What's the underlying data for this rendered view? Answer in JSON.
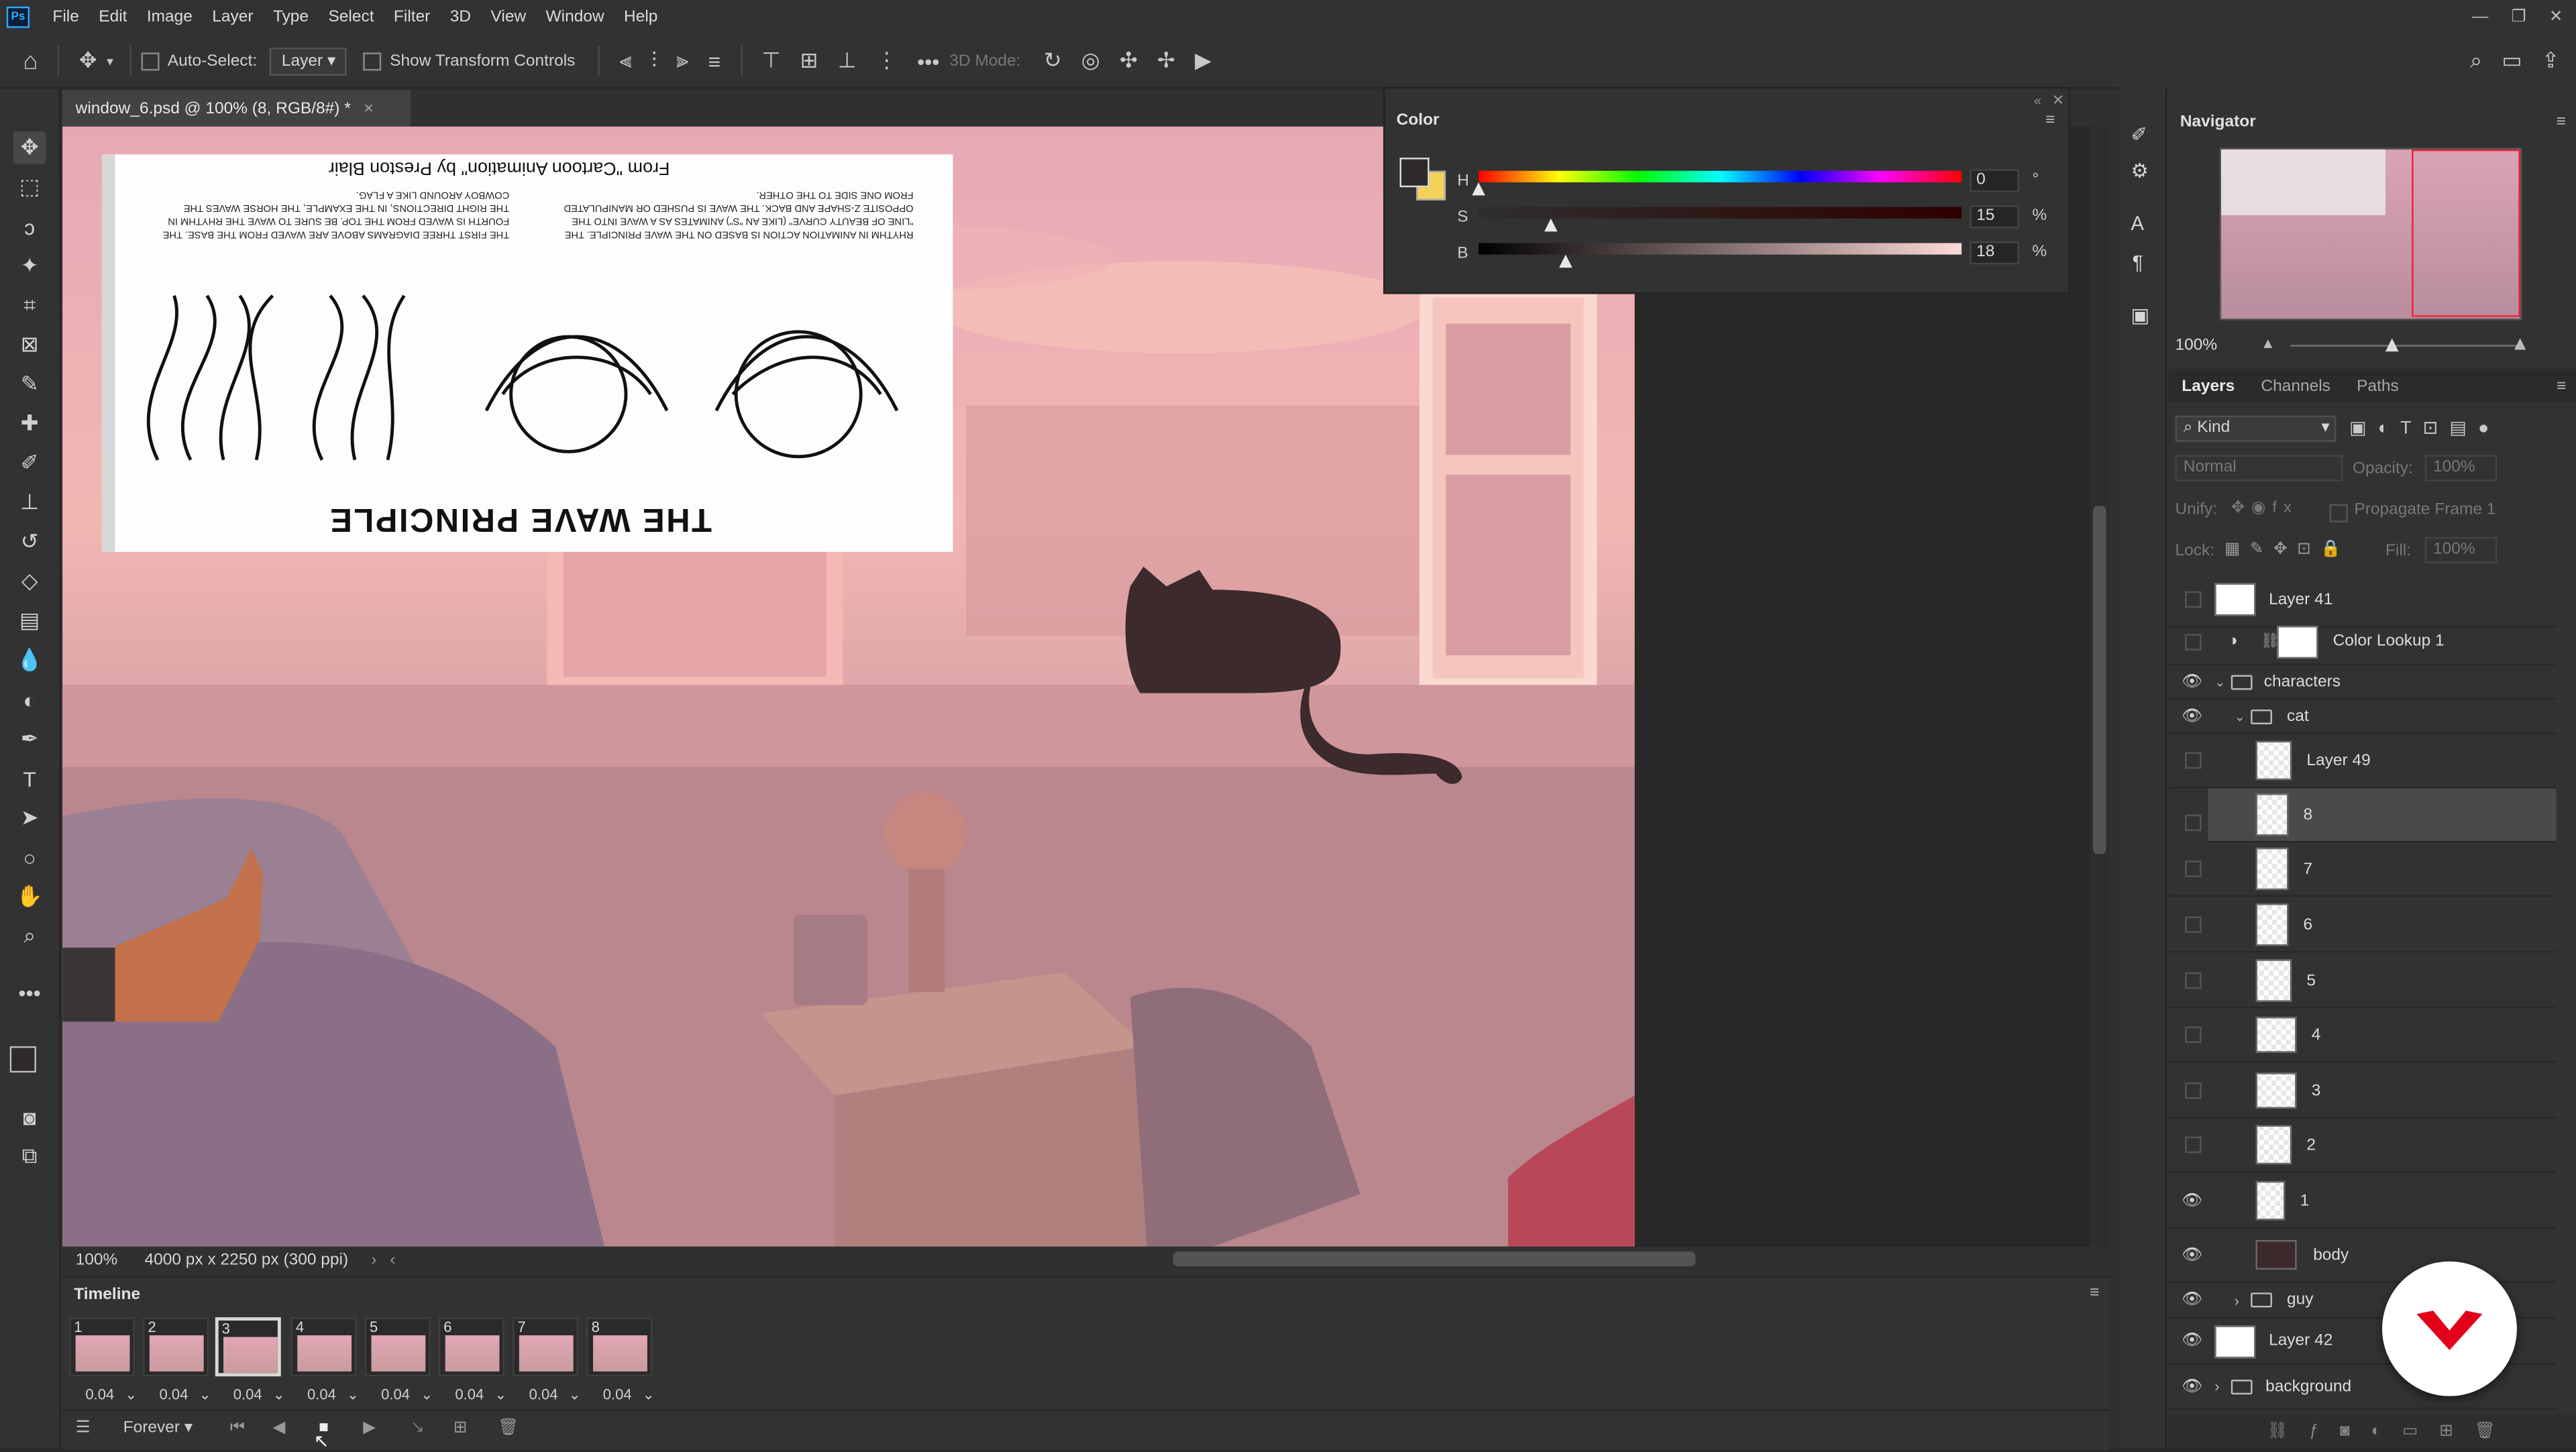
{
  "menu": {
    "logo": "Ps",
    "items": [
      "File",
      "Edit",
      "Image",
      "Layer",
      "Type",
      "Select",
      "Filter",
      "3D",
      "View",
      "Window",
      "Help"
    ]
  },
  "options": {
    "auto_select_label": "Auto-Select:",
    "auto_select_target": "Layer",
    "show_transform_label": "Show Transform Controls",
    "three_d_mode_label": "3D Mode:"
  },
  "document": {
    "tab_title": "window_6.psd @ 100% (8, RGB/8#) *",
    "close_glyph": "×",
    "zoom": "100%",
    "doc_info": "4000 px x 2250 px (300 ppi)"
  },
  "reference": {
    "heading": "THE WAVE PRINCIPLE",
    "caption": "From \"Cartoon Animation\" by Preston Blair",
    "paragraph_left": "THE FIRST THREE DIAGRAMS ABOVE ARE WAVED FROM THE BASE. THE FOURTH IS WAVED FROM THE TOP. BE SURE TO WAVE THE RHYTHM IN THE RIGHT DIRECTIONS, IN THE EXAMPLE, THE HORSE WAVES THE COWBOY AROUND LIKE A FLAG.",
    "paragraph_right": "RHYTHM IN ANIMATION ACTION IS BASED ON THE WAVE PRINCIPLE. THE \"LINE OF BEAUTY CURVE\" (LIKE AN \"S\") ANIMATES AS A WAVE INTO THE OPPOSITE Z-SHAPE AND BACK. THE WAVE IS PUSHED OR MANIPULATED FROM ONE SIDE TO THE OTHER."
  },
  "color_panel": {
    "title": "Color",
    "channels": [
      {
        "label": "H",
        "value": "0",
        "unit": "°",
        "fraction": 0.0
      },
      {
        "label": "S",
        "value": "15",
        "unit": "%",
        "fraction": 0.15
      },
      {
        "label": "B",
        "value": "18",
        "unit": "%",
        "fraction": 0.18
      }
    ],
    "foreground": "#2e2a2a",
    "background": "#f5d35a"
  },
  "navigator": {
    "title": "Navigator",
    "zoom": "100%"
  },
  "layers_panel": {
    "tabs": [
      "Layers",
      "Channels",
      "Paths"
    ],
    "filter_kind": "Kind",
    "blend_mode": "Normal",
    "opacity_label": "Opacity:",
    "opacity_value": "100%",
    "unify_label": "Unify:",
    "propagate_label": "Propagate Frame 1",
    "lock_label": "Lock:",
    "fill_label": "Fill:",
    "fill_value": "100%",
    "layers": [
      {
        "name": "Layer 41",
        "visible": false
      },
      {
        "name": "Color Lookup 1",
        "visible": false
      },
      {
        "name": "characters",
        "visible": true
      },
      {
        "name": "cat",
        "visible": true
      },
      {
        "name": "Layer 49",
        "visible": false
      },
      {
        "name": "8",
        "visible": false,
        "selected": true
      },
      {
        "name": "7",
        "visible": false
      },
      {
        "name": "6",
        "visible": false
      },
      {
        "name": "5",
        "visible": false
      },
      {
        "name": "4",
        "visible": false
      },
      {
        "name": "3",
        "visible": false
      },
      {
        "name": "2",
        "visible": false
      },
      {
        "name": "1",
        "visible": true
      },
      {
        "name": "body",
        "visible": true
      },
      {
        "name": "guy",
        "visible": false
      },
      {
        "name": "Layer 42",
        "visible": true
      },
      {
        "name": "background",
        "visible": true
      }
    ]
  },
  "timeline": {
    "title": "Timeline",
    "frames": [
      {
        "number": "1",
        "delay": "0.04"
      },
      {
        "number": "2",
        "delay": "0.04"
      },
      {
        "number": "3",
        "delay": "0.04",
        "selected": true
      },
      {
        "number": "4",
        "delay": "0.04"
      },
      {
        "number": "5",
        "delay": "0.04"
      },
      {
        "number": "6",
        "delay": "0.04"
      },
      {
        "number": "7",
        "delay": "0.04"
      },
      {
        "number": "8",
        "delay": "0.04"
      }
    ],
    "loop": "Forever"
  },
  "colors": {
    "accent": "#31a8ff",
    "brand_red": "#e3001b"
  }
}
